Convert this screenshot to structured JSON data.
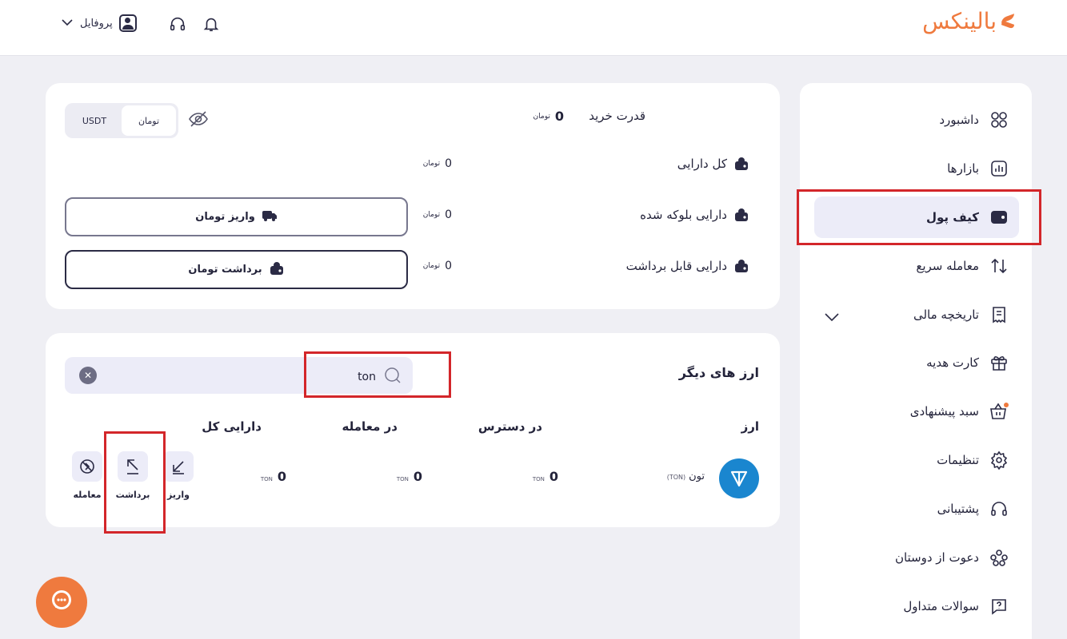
{
  "header": {
    "logo_text": "بالینکس",
    "profile_label": "پروفایل",
    "icons": [
      "bell-icon",
      "headset-icon",
      "user-icon",
      "chevron-down-icon"
    ]
  },
  "sidebar": {
    "items": [
      {
        "label": "داشبورد",
        "icon": "dashboard-icon"
      },
      {
        "label": "بازارها",
        "icon": "markets-icon"
      },
      {
        "label": "کیف پول",
        "icon": "wallet-icon",
        "active": true
      },
      {
        "label": "معامله سریع",
        "icon": "swap-icon"
      },
      {
        "label": "تاریخچه مالی",
        "icon": "receipt-icon"
      },
      {
        "label": "کارت هدیه",
        "icon": "gift-icon"
      },
      {
        "label": "سبد پیشنهادی",
        "icon": "basket-icon"
      },
      {
        "label": "تنظیمات",
        "icon": "settings-icon"
      },
      {
        "label": "پشتیبانی",
        "icon": "headset-icon"
      },
      {
        "label": "دعوت از دوستان",
        "icon": "users-icon"
      },
      {
        "label": "سوالات متداول",
        "icon": "question-icon"
      }
    ]
  },
  "balance": {
    "currency_toggle": {
      "options": [
        "تومان",
        "USDT"
      ],
      "selected": "تومان"
    },
    "buy_power_label": "قدرت خرید",
    "buy_power_value": "0",
    "toman_unit": "تومان",
    "rows": [
      {
        "label": "کل دارایی",
        "value": "0"
      },
      {
        "label": "دارایی بلوکه شده",
        "value": "0"
      },
      {
        "label": "دارایی قابل برداشت",
        "value": "0"
      }
    ],
    "deposit_button": "واریز تومان",
    "withdraw_button": "برداشت تومان"
  },
  "other_currencies": {
    "title": "ارز های دیگر",
    "search_value": "ton",
    "columns": {
      "currency": "ارز",
      "available": "در دسترس",
      "in_trade": "در معامله",
      "total": "دارایی کل"
    },
    "rows": [
      {
        "name": "تون",
        "symbol": "(TON)",
        "available": "0",
        "in_trade": "0",
        "total": "0",
        "unit": "TON",
        "actions": {
          "deposit": "واریز",
          "withdraw": "برداشت",
          "trade": "معامله"
        }
      }
    ]
  },
  "colors": {
    "brand": "#ef7a3e",
    "accent_bg": "#ececf8",
    "highlight": "#d3262a",
    "ton": "#1a86cf"
  }
}
